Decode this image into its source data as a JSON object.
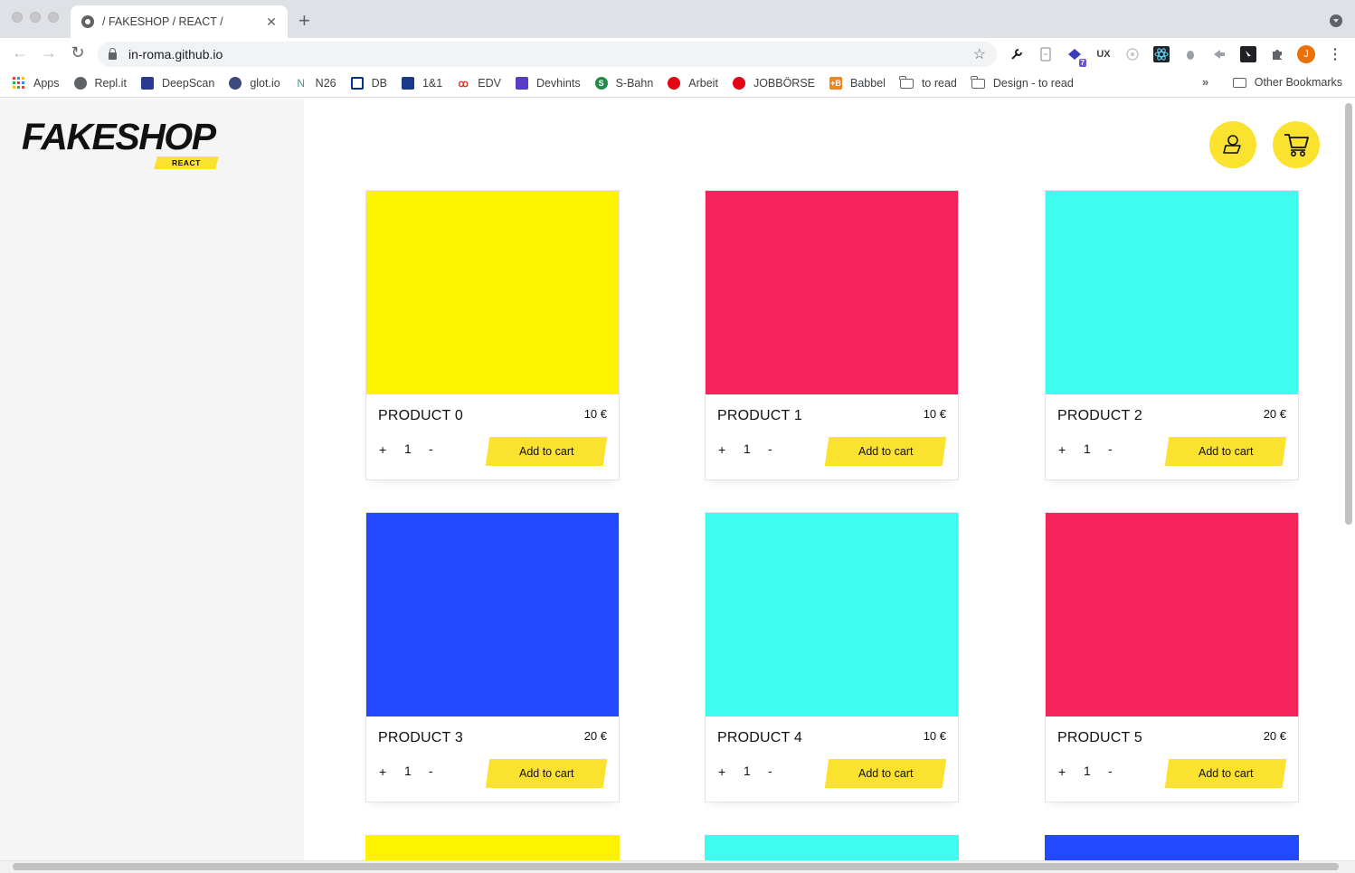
{
  "browser": {
    "tab_title": "/ FAKESHOP / REACT /",
    "tab_close": "✕",
    "new_tab": "+",
    "url": "in-roma.github.io",
    "back": "←",
    "forward": "→",
    "reload": "↻",
    "star": "☆",
    "avatar_letter": "J",
    "menu": "⋮",
    "ext_ux": "UX",
    "ext_badge": "7"
  },
  "bookmarks": {
    "items": [
      {
        "label": "Apps",
        "icon": "apps-grid-icon"
      },
      {
        "label": "Repl.it",
        "icon": "replit-icon"
      },
      {
        "label": "DeepScan",
        "icon": "deepscan-icon"
      },
      {
        "label": "glot.io",
        "icon": "glot-icon"
      },
      {
        "label": "N26",
        "icon": "n26-icon"
      },
      {
        "label": "DB",
        "icon": "db-icon"
      },
      {
        "label": "1&1",
        "icon": "one-and-one-icon"
      },
      {
        "label": "EDV",
        "icon": "edv-icon"
      },
      {
        "label": "Devhints",
        "icon": "devhints-icon"
      },
      {
        "label": "S-Bahn",
        "icon": "sbahn-icon"
      },
      {
        "label": "Arbeit",
        "icon": "arbeit-icon"
      },
      {
        "label": "JOBBÖRSE",
        "icon": "jobboerse-icon"
      },
      {
        "label": "Babbel",
        "icon": "babbel-icon"
      },
      {
        "label": "to read",
        "icon": "folder-icon"
      },
      {
        "label": "Design - to read",
        "icon": "folder-icon"
      }
    ],
    "overflow": "»",
    "other": "Other Bookmarks"
  },
  "shop": {
    "logo": "FAKESHOP",
    "logo_tag": "REACT",
    "products": [
      {
        "name": "PRODUCT 0",
        "price": "10 €",
        "qty": "1",
        "color": "#fdf200",
        "plus": "+",
        "minus": "-",
        "button": "Add to cart"
      },
      {
        "name": "PRODUCT 1",
        "price": "10 €",
        "qty": "1",
        "color": "#f7235c",
        "plus": "+",
        "minus": "-",
        "button": "Add to cart"
      },
      {
        "name": "PRODUCT 2",
        "price": "20 €",
        "qty": "1",
        "color": "#3ffcf0",
        "plus": "+",
        "minus": "-",
        "button": "Add to cart"
      },
      {
        "name": "PRODUCT 3",
        "price": "20 €",
        "qty": "1",
        "color": "#2249ff",
        "plus": "+",
        "minus": "-",
        "button": "Add to cart"
      },
      {
        "name": "PRODUCT 4",
        "price": "10 €",
        "qty": "1",
        "color": "#3ffcf0",
        "plus": "+",
        "minus": "-",
        "button": "Add to cart"
      },
      {
        "name": "PRODUCT 5",
        "price": "20 €",
        "qty": "1",
        "color": "#f7235c",
        "plus": "+",
        "minus": "-",
        "button": "Add to cart"
      }
    ],
    "partial_colors": [
      "#fdf200",
      "#3ffcf0",
      "#2249ff"
    ],
    "accent": "#fbe22f"
  }
}
